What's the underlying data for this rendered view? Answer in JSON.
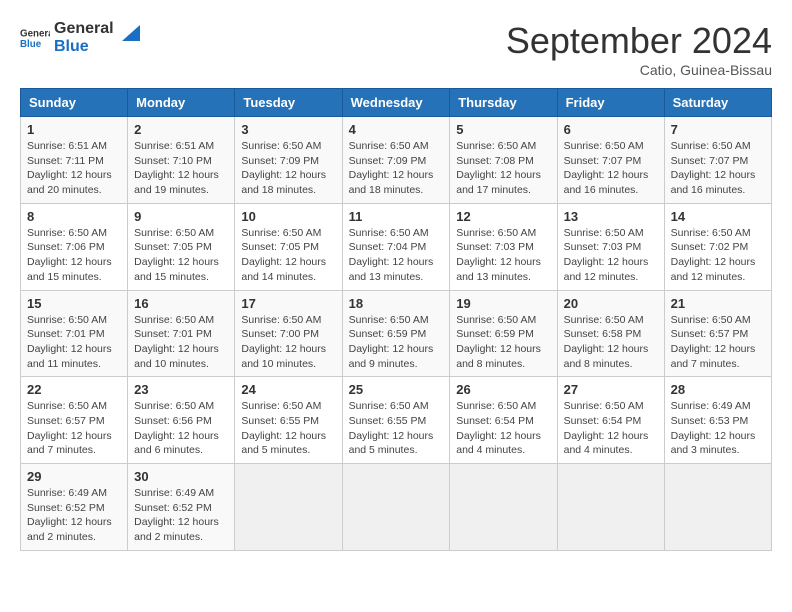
{
  "header": {
    "logo_general": "General",
    "logo_blue": "Blue",
    "month_title": "September 2024",
    "location": "Catio, Guinea-Bissau"
  },
  "days_of_week": [
    "Sunday",
    "Monday",
    "Tuesday",
    "Wednesday",
    "Thursday",
    "Friday",
    "Saturday"
  ],
  "weeks": [
    [
      {
        "day": "1",
        "sunrise": "6:51 AM",
        "sunset": "7:11 PM",
        "daylight": "12 hours and 20 minutes."
      },
      {
        "day": "2",
        "sunrise": "6:51 AM",
        "sunset": "7:10 PM",
        "daylight": "12 hours and 19 minutes."
      },
      {
        "day": "3",
        "sunrise": "6:50 AM",
        "sunset": "7:09 PM",
        "daylight": "12 hours and 18 minutes."
      },
      {
        "day": "4",
        "sunrise": "6:50 AM",
        "sunset": "7:09 PM",
        "daylight": "12 hours and 18 minutes."
      },
      {
        "day": "5",
        "sunrise": "6:50 AM",
        "sunset": "7:08 PM",
        "daylight": "12 hours and 17 minutes."
      },
      {
        "day": "6",
        "sunrise": "6:50 AM",
        "sunset": "7:07 PM",
        "daylight": "12 hours and 16 minutes."
      },
      {
        "day": "7",
        "sunrise": "6:50 AM",
        "sunset": "7:07 PM",
        "daylight": "12 hours and 16 minutes."
      }
    ],
    [
      {
        "day": "8",
        "sunrise": "6:50 AM",
        "sunset": "7:06 PM",
        "daylight": "12 hours and 15 minutes."
      },
      {
        "day": "9",
        "sunrise": "6:50 AM",
        "sunset": "7:05 PM",
        "daylight": "12 hours and 15 minutes."
      },
      {
        "day": "10",
        "sunrise": "6:50 AM",
        "sunset": "7:05 PM",
        "daylight": "12 hours and 14 minutes."
      },
      {
        "day": "11",
        "sunrise": "6:50 AM",
        "sunset": "7:04 PM",
        "daylight": "12 hours and 13 minutes."
      },
      {
        "day": "12",
        "sunrise": "6:50 AM",
        "sunset": "7:03 PM",
        "daylight": "12 hours and 13 minutes."
      },
      {
        "day": "13",
        "sunrise": "6:50 AM",
        "sunset": "7:03 PM",
        "daylight": "12 hours and 12 minutes."
      },
      {
        "day": "14",
        "sunrise": "6:50 AM",
        "sunset": "7:02 PM",
        "daylight": "12 hours and 12 minutes."
      }
    ],
    [
      {
        "day": "15",
        "sunrise": "6:50 AM",
        "sunset": "7:01 PM",
        "daylight": "12 hours and 11 minutes."
      },
      {
        "day": "16",
        "sunrise": "6:50 AM",
        "sunset": "7:01 PM",
        "daylight": "12 hours and 10 minutes."
      },
      {
        "day": "17",
        "sunrise": "6:50 AM",
        "sunset": "7:00 PM",
        "daylight": "12 hours and 10 minutes."
      },
      {
        "day": "18",
        "sunrise": "6:50 AM",
        "sunset": "6:59 PM",
        "daylight": "12 hours and 9 minutes."
      },
      {
        "day": "19",
        "sunrise": "6:50 AM",
        "sunset": "6:59 PM",
        "daylight": "12 hours and 8 minutes."
      },
      {
        "day": "20",
        "sunrise": "6:50 AM",
        "sunset": "6:58 PM",
        "daylight": "12 hours and 8 minutes."
      },
      {
        "day": "21",
        "sunrise": "6:50 AM",
        "sunset": "6:57 PM",
        "daylight": "12 hours and 7 minutes."
      }
    ],
    [
      {
        "day": "22",
        "sunrise": "6:50 AM",
        "sunset": "6:57 PM",
        "daylight": "12 hours and 7 minutes."
      },
      {
        "day": "23",
        "sunrise": "6:50 AM",
        "sunset": "6:56 PM",
        "daylight": "12 hours and 6 minutes."
      },
      {
        "day": "24",
        "sunrise": "6:50 AM",
        "sunset": "6:55 PM",
        "daylight": "12 hours and 5 minutes."
      },
      {
        "day": "25",
        "sunrise": "6:50 AM",
        "sunset": "6:55 PM",
        "daylight": "12 hours and 5 minutes."
      },
      {
        "day": "26",
        "sunrise": "6:50 AM",
        "sunset": "6:54 PM",
        "daylight": "12 hours and 4 minutes."
      },
      {
        "day": "27",
        "sunrise": "6:50 AM",
        "sunset": "6:54 PM",
        "daylight": "12 hours and 4 minutes."
      },
      {
        "day": "28",
        "sunrise": "6:49 AM",
        "sunset": "6:53 PM",
        "daylight": "12 hours and 3 minutes."
      }
    ],
    [
      {
        "day": "29",
        "sunrise": "6:49 AM",
        "sunset": "6:52 PM",
        "daylight": "12 hours and 2 minutes."
      },
      {
        "day": "30",
        "sunrise": "6:49 AM",
        "sunset": "6:52 PM",
        "daylight": "12 hours and 2 minutes."
      },
      null,
      null,
      null,
      null,
      null
    ]
  ],
  "labels": {
    "sunrise_prefix": "Sunrise: ",
    "sunset_prefix": "Sunset: ",
    "daylight_prefix": "Daylight: "
  }
}
